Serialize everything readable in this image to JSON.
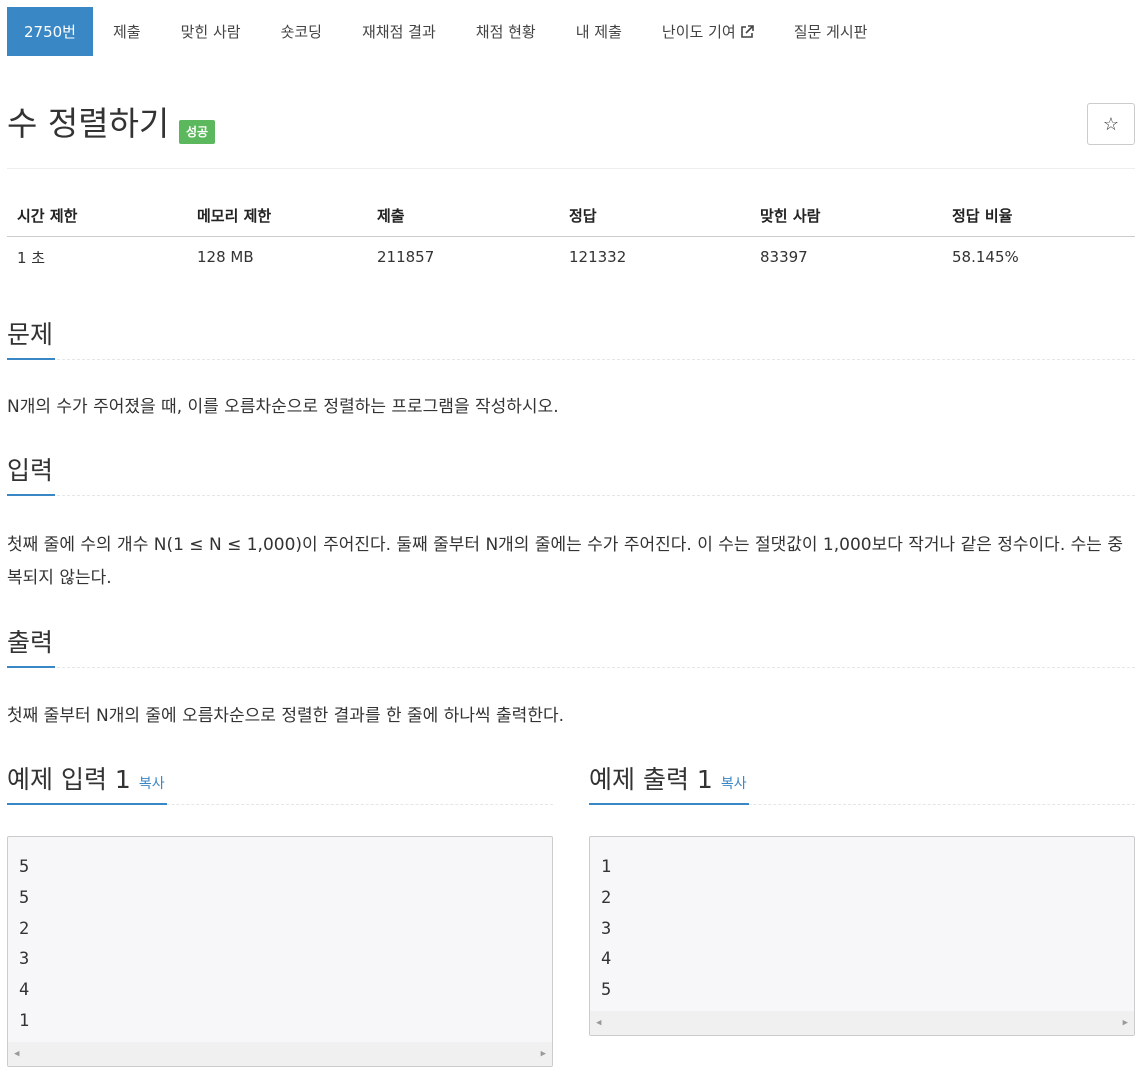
{
  "nav": {
    "items": [
      {
        "label": "2750번",
        "active": true
      },
      {
        "label": "제출"
      },
      {
        "label": "맞힌 사람"
      },
      {
        "label": "숏코딩"
      },
      {
        "label": "재채점 결과"
      },
      {
        "label": "채점 현황"
      },
      {
        "label": "내 제출"
      },
      {
        "label": "난이도 기여",
        "external": true
      },
      {
        "label": "질문 게시판"
      }
    ]
  },
  "problem": {
    "title": "수 정렬하기",
    "badge": "성공",
    "star_icon": "☆"
  },
  "info_table": {
    "headers": [
      "시간 제한",
      "메모리 제한",
      "제출",
      "정답",
      "맞힌 사람",
      "정답 비율"
    ],
    "values": [
      "1 초",
      "128 MB",
      "211857",
      "121332",
      "83397",
      "58.145%"
    ]
  },
  "sections": {
    "problem": {
      "heading": "문제",
      "text": "N개의 수가 주어졌을 때, 이를 오름차순으로 정렬하는 프로그램을 작성하시오."
    },
    "input": {
      "heading": "입력",
      "text": "첫째 줄에 수의 개수 N(1 ≤ N ≤ 1,000)이 주어진다. 둘째 줄부터 N개의 줄에는 수가 주어진다. 이 수는 절댓값이 1,000보다 작거나 같은 정수이다. 수는 중복되지 않는다."
    },
    "output": {
      "heading": "출력",
      "text": "첫째 줄부터 N개의 줄에 오름차순으로 정렬한 결과를 한 줄에 하나씩 출력한다."
    }
  },
  "samples": {
    "input": {
      "heading": "예제 입력 1",
      "copy_label": "복사",
      "lines": [
        "5",
        "5",
        "2",
        "3",
        "4",
        "1"
      ]
    },
    "output": {
      "heading": "예제 출력 1",
      "copy_label": "복사",
      "lines": [
        "1",
        "2",
        "3",
        "4",
        "5"
      ]
    }
  },
  "colors": {
    "accent": "#3a87c6",
    "success": "#5cb85c"
  }
}
